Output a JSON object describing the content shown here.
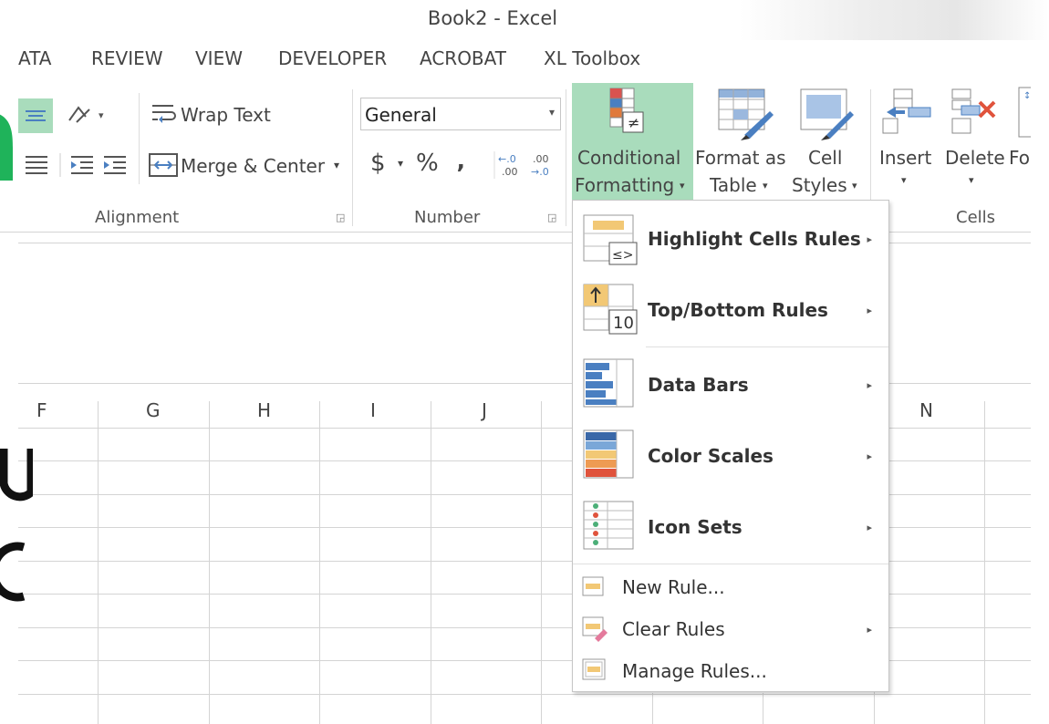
{
  "window": {
    "title": "Book2 - Excel"
  },
  "tabs": [
    "ATA",
    "REVIEW",
    "VIEW",
    "DEVELOPER",
    "ACROBAT",
    "XL Toolbox"
  ],
  "alignment": {
    "wrap_text": "Wrap Text",
    "merge_center": "Merge & Center",
    "group_label": "Alignment"
  },
  "number": {
    "format_value": "General",
    "currency": "$",
    "percent": "%",
    "comma": "‚",
    "increase_decimal": "←.0\n.00",
    "decrease_decimal": ".00\n→.0",
    "group_label": "Number"
  },
  "styles": {
    "conditional_line1": "Conditional",
    "conditional_line2": "Formatting",
    "format_table_line1": "Format as",
    "format_table_line2": "Table",
    "cell_styles_line1": "Cell",
    "cell_styles_line2": "Styles"
  },
  "cells": {
    "insert": "Insert",
    "delete": "Delete",
    "format_partial": "Fo",
    "group_label": "Cells"
  },
  "columns": [
    "F",
    "G",
    "H",
    "I",
    "J",
    "N"
  ],
  "menu": {
    "items": [
      {
        "label": "Highlight Cells Rules",
        "bold": true,
        "submenu": true
      },
      {
        "label": "Top/Bottom Rules",
        "bold": true,
        "submenu": true
      },
      {
        "label": "Data Bars",
        "bold": true,
        "submenu": true
      },
      {
        "label": "Color Scales",
        "bold": true,
        "submenu": true
      },
      {
        "label": "Icon Sets",
        "bold": true,
        "submenu": true
      },
      {
        "label": "New Rule...",
        "bold": false,
        "submenu": false
      },
      {
        "label": "Clear Rules",
        "bold": false,
        "submenu": true
      },
      {
        "label": "Manage Rules...",
        "bold": false,
        "submenu": false
      }
    ],
    "topbottom_badge": "10"
  },
  "colors": {
    "accent_green": "#a9dcbc",
    "excel_green": "#1fb35a",
    "bar_blue": "#4a7fc1",
    "highlight_yellow": "#f2c875",
    "orange": "#e07a3c"
  }
}
